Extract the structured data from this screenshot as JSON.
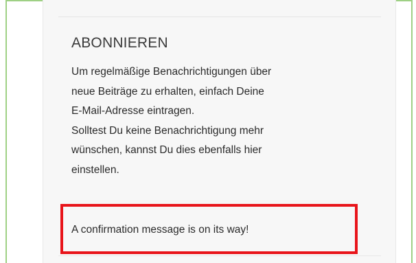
{
  "widget": {
    "title": "ABONNIEREN",
    "description_lines": [
      "Um regelmäßige Benachrichtigungen über",
      "neue Beiträge zu erhalten, einfach Deine",
      "E-Mail-Adresse eintragen.",
      "Solltest Du keine Benachrichtigung mehr",
      "wünschen, kannst Du dies ebenfalls hier",
      "einstellen."
    ],
    "confirmation_message": "A confirmation message is on its way!"
  },
  "colors": {
    "frame_border": "#9ed084",
    "highlight_border": "#e8141a",
    "sidebar_background": "#f7f7f7"
  }
}
